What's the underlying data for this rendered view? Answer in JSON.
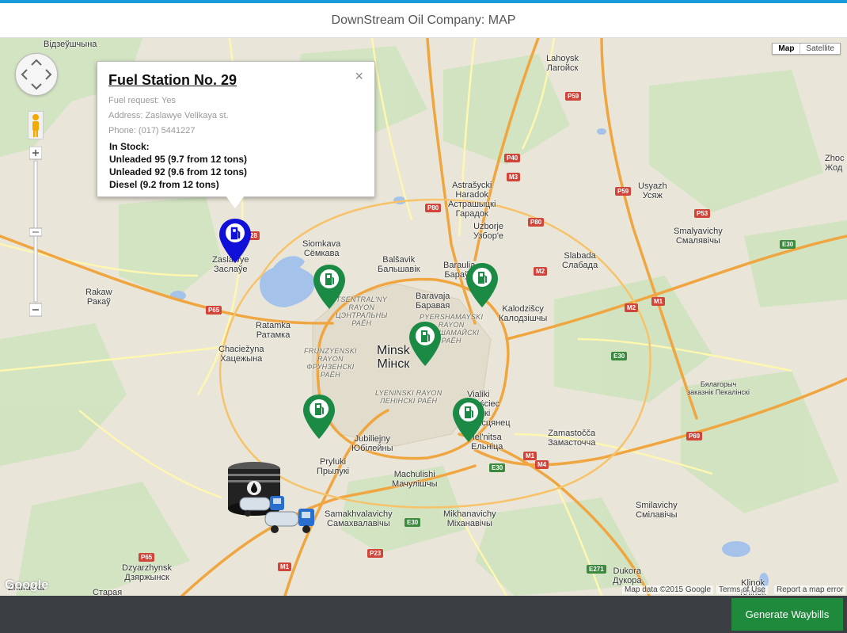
{
  "header": {
    "title": "DownStream Oil Company: MAP"
  },
  "map_type": {
    "map_label": "Map",
    "satellite_label": "Satellite",
    "active": "Map"
  },
  "info_window": {
    "title": "Fuel Station No. 29",
    "fuel_request": "Fuel request: Yes",
    "address": "Address: Zaslawye Velikaya st.",
    "phone": "Phone: (017) 5441227",
    "in_stock_label": "In Stock:",
    "stock": [
      "Unleaded 95 (9.7 from 12 tons)",
      "Unleaded 92 (9.6 from 12 tons)",
      "Diesel (9.2 from 12 tons)"
    ],
    "close_glyph": "×"
  },
  "markers": {
    "selected_color": "#1010d8",
    "station_color": "#1a8a45"
  },
  "map_labels": {
    "vidzeyshchyna": "Відзеўшчына",
    "lahoysk": "Lahoysk\nЛагойск",
    "zhodzina": "Zhoc\nЖод",
    "astrashycki": "Astrašycki\nHaradok\nАстрашыцкі\nГарадок",
    "usyazh": "Usyazh\nУсяж",
    "uzborje": "Uzborje\nУзбор'е",
    "smalyavichy": "Smalyavichy\nСмалявічы",
    "siomkava": "Siomkava\nСёмкава",
    "zaslawye": "Zaslawye\nЗаслаўе",
    "balshavik": "Balšavik\nБальшавік",
    "baraulia": "Baraulia\nБараўл",
    "slabada": "Slabada\nСлабада",
    "rakaw": "Rakaw\nРакаў",
    "baravaja": "Baravaja\nБаравая",
    "kalodzishchy": "Kalodzišcy\nКалодзішчы",
    "ratamka": "Ratamka\nРатамка",
    "chaciezhyna": "Chaciežyna\nХацежына",
    "minsk": "Minsk\nМінск",
    "vialiki": "Vialiki\nTraściec\nВялікі\nТрасцянец",
    "jubiliejny": "Jubiliejny\nЮбілейны",
    "zamastochcha": "Zamastočča\nЗамасточча",
    "biaĺahrad": "Бялагорыч\nзаказнік Пекалінскі",
    "pryluki": "Pryluki\nПрылукі",
    "machulishchy": "Machulishi\nМачулішчы",
    "ielnitsa": "Ĭel'nitsa\nЕльніца",
    "smilavichy": "Smilavichy\nСмілавічы",
    "samakhvalavichy": "Samakhvalavichy\nСамахвалавічы",
    "mikhanavichy": "Mikhanavichy\nМіханавічы",
    "dzyarzhynsk": "Dzyarzhynsk\nДзяржынск",
    "dukora": "Dukora\nДукора",
    "klinok": "Klinok\nКлінок",
    "staraya": "Старая",
    "zhuravka": "Zhuravka",
    "rayon_tsentral": "TSENTRAL'NY\nRAYON\nЦЭНТРАЛЬНЫ\nРАЁН",
    "rayon_frunz": "FRUNZYENSKI\nRAYON\nФРУНЗЕНСКІ\nРАЁН",
    "rayon_pyersh": "PYERSHAMAYSKI\nRAYON\nПЕРШАМАЙСКІ\nРАЁН",
    "rayon_lyen": "LYENINSKI RAYON\nЛЕНІНСКІ РАЁН"
  },
  "road_shields": {
    "p59a": "P59",
    "p40": "P40",
    "m3": "M3",
    "p80a": "P80",
    "p80b": "P80",
    "p59b": "P59",
    "p53": "P53",
    "e30a": "E30",
    "m2a": "M2",
    "m2b": "M2",
    "m1a": "M1",
    "e30b": "E30",
    "p65a": "P65",
    "p69": "P69",
    "m1b": "M1",
    "m4": "M4",
    "e30c": "E30",
    "e30d": "E30",
    "p23": "P23",
    "p65b": "P65",
    "m1c": "M1",
    "e271": "E271",
    "p28": "28"
  },
  "attribution": {
    "map_data": "Map data ©2015 Google",
    "terms": "Terms of Use",
    "report": "Report a map error",
    "google": "Google"
  },
  "footer": {
    "generate_label": "Generate Waybills"
  }
}
